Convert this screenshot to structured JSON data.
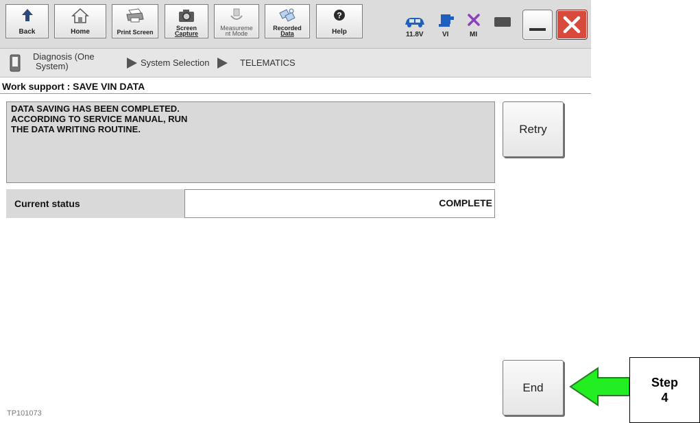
{
  "toolbar": {
    "buttons": [
      {
        "label": "Back",
        "icon": "back-arrow-icon"
      },
      {
        "label": "Home",
        "icon": "home-icon"
      },
      {
        "label": "Print Screen",
        "icon": "printer-icon"
      },
      {
        "label_line1": "Screen",
        "label_line2": "Capture",
        "icon": "camera-icon"
      },
      {
        "label_line1": "Measureme",
        "label_line2": "nt Mode",
        "icon": "measurement-icon"
      },
      {
        "label_line1": "Recorded",
        "label_line2": "Data",
        "icon": "recorded-data-icon"
      },
      {
        "label": "Help",
        "icon": "help-icon"
      }
    ],
    "status": {
      "voltage": "11.8V",
      "vi_label": "VI",
      "mi_label": "MI"
    }
  },
  "breadcrumb": {
    "items": [
      "Diagnosis (One System)",
      "System Selection",
      "TELEMATICS"
    ],
    "first_line1": "Diagnosis (One",
    "first_line2": "System)"
  },
  "page": {
    "title": "Work support : SAVE VIN DATA",
    "message_lines": [
      "DATA SAVING HAS BEEN COMPLETED.",
      "ACCORDING TO SERVICE MANUAL, RUN",
      "THE DATA WRITING ROUTINE."
    ],
    "retry_label": "Retry",
    "status_label": "Current status",
    "status_value": "COMPLETE",
    "end_label": "End"
  },
  "footer": {
    "code": "TP101073"
  },
  "annotation": {
    "step_line1": "Step",
    "step_line2": "4"
  },
  "colors": {
    "callout_arrow": "#22ee22",
    "close_button": "#d84b3c",
    "toolbar_icon_blue": "#1f5fbf"
  }
}
